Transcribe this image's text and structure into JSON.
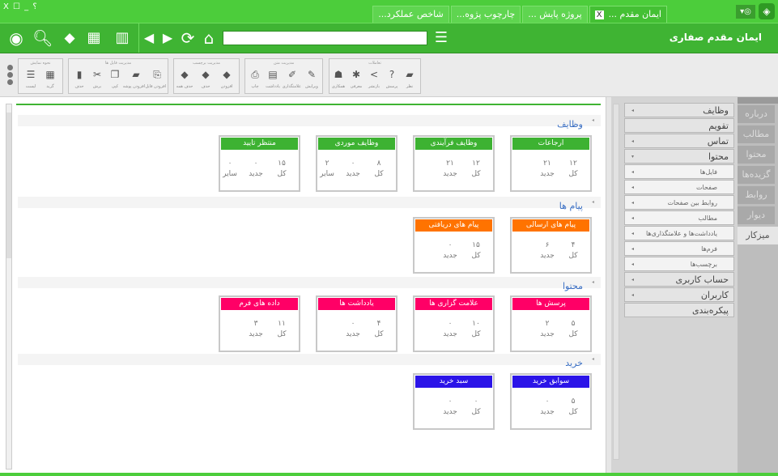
{
  "window": {
    "controls": "X ☐ _ ؟",
    "tabs": [
      {
        "label": "ایمان مقدم ...",
        "active": true,
        "close": "X"
      },
      {
        "label": "پروژه پایش ..."
      },
      {
        "label": "چارچوب پژوه..."
      },
      {
        "label": "شاخص عملکرد..."
      }
    ],
    "lang_icon": "globe-icon"
  },
  "navbar": {
    "user_name": "ایمان مقدم صفاری",
    "address": ""
  },
  "toolbar": {
    "groups": [
      {
        "title": "تعاملات",
        "buttons": [
          "نظر",
          "پرسش",
          "بازنشر",
          "معرفی",
          "همکاری"
        ]
      },
      {
        "title": "مدیریت متن",
        "buttons": [
          "ویرایش",
          "علامتگذاری",
          "یادداشت",
          "چاپ"
        ]
      },
      {
        "title": "مدیریت برچسب",
        "buttons": [
          "افزودن",
          "حذف",
          "حذف همه"
        ]
      },
      {
        "title": "مدیریت فایل ها",
        "buttons": [
          "افزودن فایل",
          "افزودن پوشه",
          "کپی",
          "برش",
          "حذف"
        ]
      },
      {
        "title": "نحوه نمایش",
        "buttons": [
          "گرید",
          "لیست"
        ]
      }
    ]
  },
  "colors": {
    "green": "#3db232",
    "orange": "#ff7300",
    "pink": "#ff0066",
    "blue": "#2b14e8",
    "brand": "#4ccd3b"
  },
  "sections": [
    {
      "title": "وظایف",
      "cards": [
        {
          "title": "ارجاعات",
          "color": "#3db232",
          "stats": [
            {
              "label": "کل",
              "value": "۱۲"
            },
            {
              "label": "جدید",
              "value": "۲۱"
            }
          ]
        },
        {
          "title": "وظایف فرآیندی",
          "color": "#3db232",
          "stats": [
            {
              "label": "کل",
              "value": "۱۲"
            },
            {
              "label": "جدید",
              "value": "۲۱"
            }
          ]
        },
        {
          "title": "وظایف موردی",
          "color": "#3db232",
          "stats": [
            {
              "label": "کل",
              "value": "۸"
            },
            {
              "label": "جدید",
              "value": "۰"
            },
            {
              "label": "سایر",
              "value": "۲"
            }
          ]
        },
        {
          "title": "منتظر تایید",
          "color": "#3db232",
          "stats": [
            {
              "label": "کل",
              "value": "۱۵"
            },
            {
              "label": "جدید",
              "value": "۰"
            },
            {
              "label": "سایر",
              "value": "۰"
            }
          ]
        }
      ]
    },
    {
      "title": "پیام ها",
      "cards": [
        {
          "title": "پیام های ارسالی",
          "color": "#ff7300",
          "stats": [
            {
              "label": "کل",
              "value": "۴"
            },
            {
              "label": "جدید",
              "value": "۶"
            }
          ]
        },
        {
          "title": "پیام های دریافتی",
          "color": "#ff7300",
          "stats": [
            {
              "label": "کل",
              "value": "۱۵"
            },
            {
              "label": "جدید",
              "value": "۰"
            }
          ]
        }
      ]
    },
    {
      "title": "محتوا",
      "cards": [
        {
          "title": "پرسش ها",
          "color": "#ff0066",
          "stats": [
            {
              "label": "کل",
              "value": "۵"
            },
            {
              "label": "جدید",
              "value": "۲"
            }
          ]
        },
        {
          "title": "علامت گزاری ها",
          "color": "#ff0066",
          "stats": [
            {
              "label": "کل",
              "value": "۱۰"
            },
            {
              "label": "جدید",
              "value": "۰"
            }
          ]
        },
        {
          "title": "یادداشت ها",
          "color": "#ff0066",
          "stats": [
            {
              "label": "کل",
              "value": "۴"
            },
            {
              "label": "جدید",
              "value": "۰"
            }
          ]
        },
        {
          "title": "داده های فرم",
          "color": "#ff0066",
          "stats": [
            {
              "label": "کل",
              "value": "۱۱"
            },
            {
              "label": "جدید",
              "value": "۳"
            }
          ]
        }
      ]
    },
    {
      "title": "خرید",
      "cards": [
        {
          "title": "سوابق خرید",
          "color": "#2b14e8",
          "stats": [
            {
              "label": "کل",
              "value": "۵"
            },
            {
              "label": "جدید",
              "value": "۰"
            }
          ]
        },
        {
          "title": "سبد خرید",
          "color": "#2b14e8",
          "stats": [
            {
              "label": "کل",
              "value": "۰"
            },
            {
              "label": "جدید",
              "value": "۰"
            }
          ]
        }
      ]
    }
  ],
  "accordion": [
    {
      "label": "وظایف",
      "arrow": "◂"
    },
    {
      "label": "تقویم"
    },
    {
      "label": "تماس",
      "arrow": "◂"
    },
    {
      "label": "محتوا",
      "arrow": "▾"
    },
    {
      "label": "فایل‌ها",
      "sub": true,
      "arrow": "◂"
    },
    {
      "label": "صفحات",
      "sub": true,
      "arrow": "◂"
    },
    {
      "label": "روابط بین صفحات",
      "sub": true,
      "arrow": "◂"
    },
    {
      "label": "مطالب",
      "sub": true,
      "arrow": "◂"
    },
    {
      "label": "یادداشت‌ها و علامتگذاری‌ها",
      "sub": true,
      "arrow": "◂"
    },
    {
      "label": "فرم‌ها",
      "sub": true,
      "arrow": "◂"
    },
    {
      "label": "برچسب‌ها",
      "sub": true,
      "arrow": "◂"
    },
    {
      "label": "حساب کاربری",
      "arrow": "◂"
    },
    {
      "label": "کاربران",
      "arrow": "◂"
    },
    {
      "label": "پیکره‌بندی"
    }
  ],
  "vertical_tabs": [
    {
      "label": "درباره"
    },
    {
      "label": "مطالب"
    },
    {
      "label": "محتوا"
    },
    {
      "label": "گزیده‌ها"
    },
    {
      "label": "روابط"
    },
    {
      "label": "دیوار"
    },
    {
      "label": "میزکار",
      "active": true
    }
  ]
}
